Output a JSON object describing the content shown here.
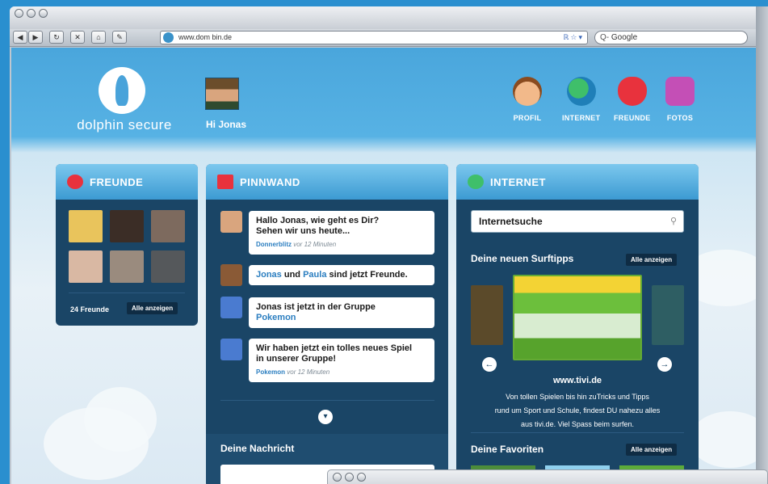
{
  "browser": {
    "url": "www.dom bin.de",
    "search_placeholder": "Google",
    "search_prefix": "Q-"
  },
  "header": {
    "brand": "dolphin secure",
    "greeting": "Hi Jonas",
    "nav": [
      {
        "label": "PROFIL",
        "icon": "face-icon"
      },
      {
        "label": "INTERNET",
        "icon": "globe-icon"
      },
      {
        "label": "FREUNDE",
        "icon": "heart-icon"
      },
      {
        "label": "FOTOS",
        "icon": "camera-icon"
      }
    ]
  },
  "friends": {
    "title": "FREUNDE",
    "count": "24 Freunde",
    "show_all": "Alle anzeigen"
  },
  "wall": {
    "title": "PINNWAND",
    "posts": [
      {
        "line1": "Hallo Jonas, wie geht es Dir?",
        "line2": "Sehen wir uns heute...",
        "author": "Donnerblitz",
        "time": "vor 12 Minuten"
      },
      {
        "name1": "Jonas",
        "mid": "und",
        "name2": "Paula",
        "rest": "sind jetzt Freunde."
      },
      {
        "line1": "Jonas ist jetzt in der Gruppe",
        "group": "Pokemon"
      },
      {
        "line1": "Wir haben jetzt ein tolles neues Spiel",
        "line2": "in unserer Gruppe!",
        "author": "Pokemon",
        "time": "vor 12 Minuten"
      }
    ],
    "message_title": "Deine Nachricht"
  },
  "internet": {
    "title": "INTERNET",
    "search_value": "Internetsuche",
    "surftipps_title": "Deine neuen Surftipps",
    "show_all": "Alle anzeigen",
    "site_title": "www.tivi.de",
    "site_text1": "Von tollen Spielen bis hin zuTricks und Tipps",
    "site_text2": "rund um Sport und Schule, findest DU nahezu alles",
    "site_text3": "aus tivi.de. Viel Spass beim surfen.",
    "favorites_title": "Deine Favoriten",
    "favorites_show_all": "Alle anzeigen"
  },
  "colors": {
    "panel": "#1a4566",
    "header_sky": "#4aa6dc",
    "accent_blue": "#2b7ec0"
  }
}
